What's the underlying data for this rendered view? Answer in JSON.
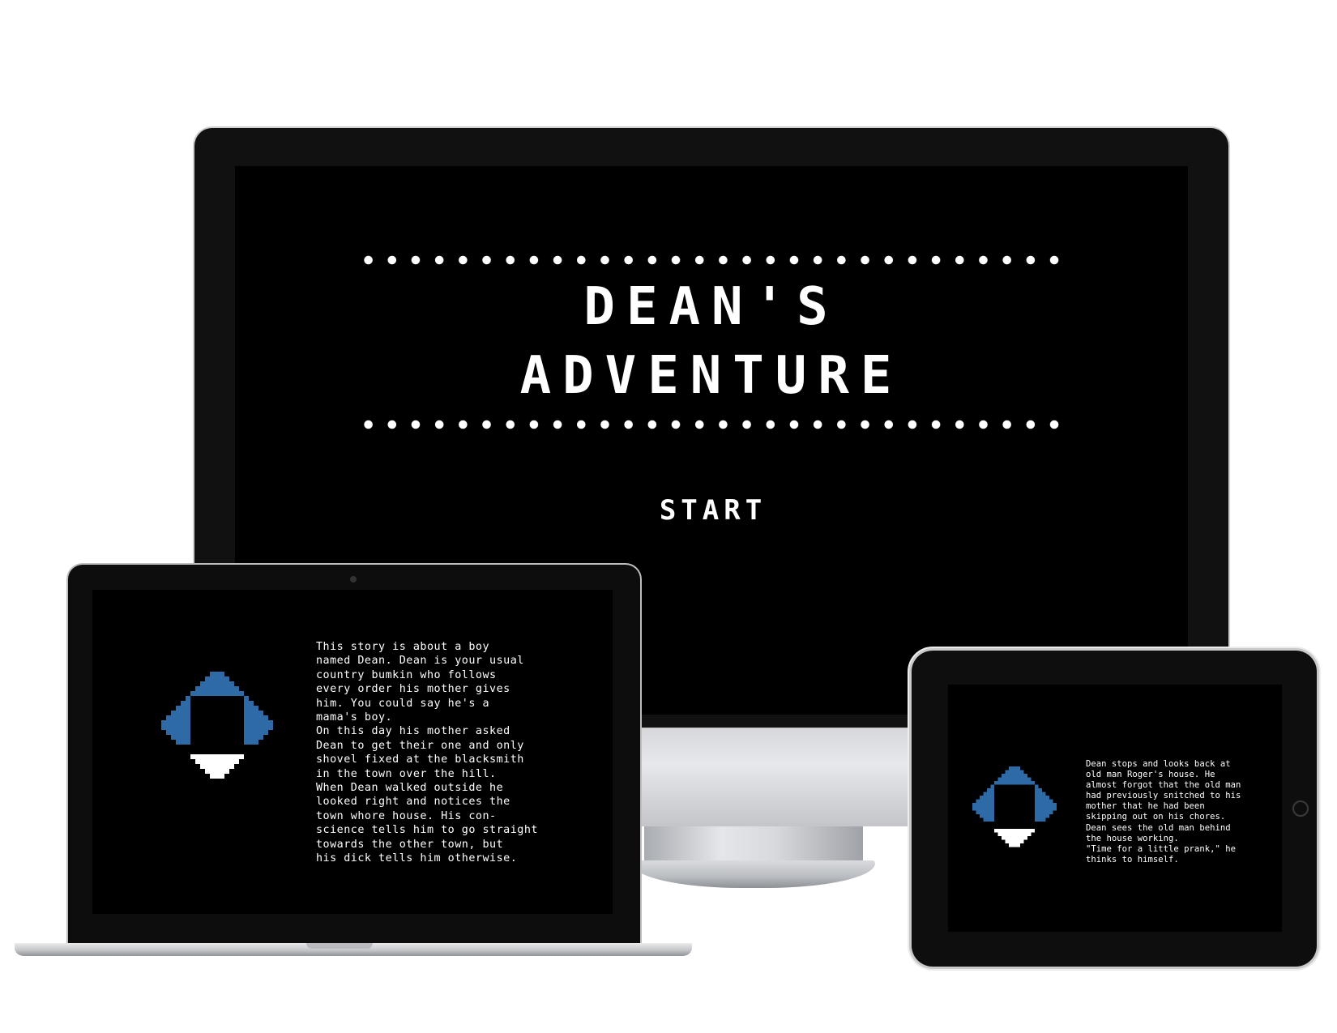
{
  "desktop": {
    "title_line_1": "DEAN'S",
    "title_line_2": "ADVENTURE",
    "start_label": "START"
  },
  "laptop": {
    "story_text": "This story is about a boy\nnamed Dean. Dean is your usual\ncountry bumkin who follows\nevery order his mother gives\nhim. You could say he's a\nmama's boy.\nOn this day his mother asked\nDean to get their one and only\nshovel fixed at the blacksmith\nin the town over the hill.\nWhen Dean walked outside he\nlooked right and notices the\ntown whore house. His con-\nscience tells him to go straight\ntowards the other town, but\nhis dick tells him otherwise."
  },
  "tablet": {
    "story_text": "Dean stops and looks back at\nold man Roger's house. He\nalmost forgot that the old man\nhad previously snitched to his\nmother that he had been\nskipping out on his chores.\nDean sees the old man behind\nthe house working.\n\"Time for a little prank,\" he\nthinks to himself."
  },
  "colors": {
    "screen_background": "#000000",
    "text": "#ffffff",
    "avatar_blue": "#2d6aa6"
  },
  "icons": {
    "dean_sprite": "dean-sprite-icon"
  }
}
